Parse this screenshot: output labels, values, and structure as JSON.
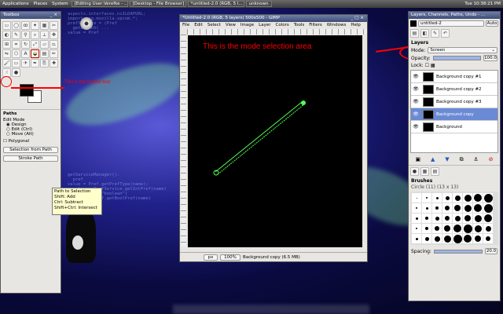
{
  "topbar": {
    "apps": "Applications",
    "places": "Places",
    "system": "System",
    "tasks": [
      "[Editing User:Verefke - ...",
      "[Desktop - File Browser]",
      "*untitled-2.0 (RGB, 5 l...",
      "unknown"
    ],
    "clock": "Tue 10:38:21 PM"
  },
  "toolbox": {
    "title": "Toolbox",
    "paths_label": "Paths",
    "edit_mode": "Edit Mode",
    "modes": [
      "Design",
      "Edit (Ctrl)",
      "Move (Alt)"
    ],
    "polygonal": "Polygonal",
    "selection_btn": "Selection from Path",
    "stroke_btn": "Stroke Path",
    "tooltip": [
      "Path to Selection",
      "Shift: Add",
      "Ctrl: Subtract",
      "Shift+Ctrl: Intersect"
    ]
  },
  "image_window": {
    "title": "*Untitled-2.0 (RGB, 5 layers) 500x500 - GIMP",
    "menus": [
      "File",
      "Edit",
      "Select",
      "View",
      "Image",
      "Layer",
      "Colors",
      "Tools",
      "Filters",
      "Windows",
      "Help"
    ],
    "unit": "px",
    "zoom": "100%",
    "status": "Background copy (6.5 MB)"
  },
  "annotations": {
    "mode": "This is the mode selection area",
    "tool": "This is the bucket tool"
  },
  "layers": {
    "title": "Layers, Channels, Paths, Undo - ...",
    "image_select": "untitled-2",
    "auto": "Auto",
    "section": "Layers",
    "mode_label": "Mode:",
    "mode_value": "Screen",
    "opacity_label": "Opacity:",
    "opacity_value": "100.0",
    "lock_label": "Lock:",
    "rows": [
      "Background copy #1",
      "Background copy #2",
      "Background copy #3",
      "Background copy",
      "Background"
    ],
    "selected": 3
  },
  "brushes": {
    "title": "Brushes",
    "current": "Circle (11) (13 x 13)",
    "spacing_label": "Spacing:",
    "spacing_value": "20.0"
  },
  "colors": {
    "accent": "#6a8ad6",
    "annotation": "#ff0000",
    "path": "#55ff55"
  }
}
